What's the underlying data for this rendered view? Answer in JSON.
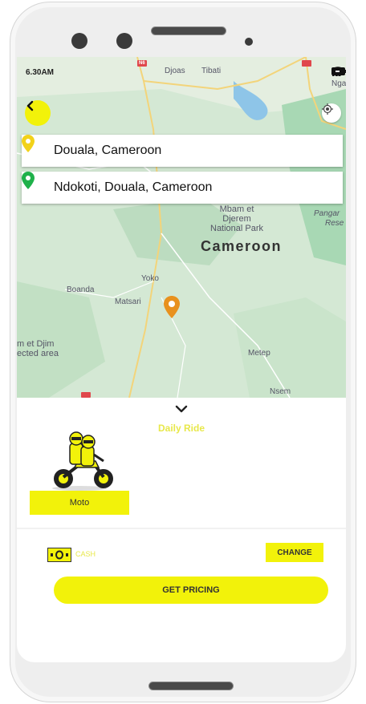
{
  "status_bar": {
    "time": "6.30AM"
  },
  "map": {
    "country_label": "Cameroon",
    "park_label_line1": "Mbam et",
    "park_label_line2": "Djerem",
    "park_label_line3": "National Park",
    "places": {
      "djoas": "Djoas",
      "tibati": "Tibati",
      "ngaou": "Ngaou",
      "boanda": "Boanda",
      "yoko": "Yoko",
      "matsari": "Matsari",
      "metep": "Metep",
      "nsem": "Nsem",
      "pangar": "Pangar",
      "rese": "Rese",
      "mbam_line1": "m et Djim",
      "mbam_line2": "ected area",
      "road_label": "N6"
    }
  },
  "route": {
    "origin": "Douala, Cameroon",
    "destination": "Ndokoti, Douala, Cameroon"
  },
  "ride": {
    "type_label": "Daily Ride",
    "vehicle_label": "Moto"
  },
  "payment": {
    "method_label": "CASH",
    "change_label": "CHANGE"
  },
  "actions": {
    "get_pricing_label": "GET PRICING"
  },
  "colors": {
    "accent": "#f2f20a",
    "origin_pin": "#f2d21a",
    "destination_pin": "#1fb14a",
    "driver_pin": "#e8911e"
  },
  "icons": [
    "back-arrow-icon",
    "locate-icon",
    "wifi-icon",
    "signal-icon",
    "battery-icon",
    "location-pin-icon",
    "chevron-down-icon",
    "moto-rider-icon",
    "cash-icon"
  ]
}
